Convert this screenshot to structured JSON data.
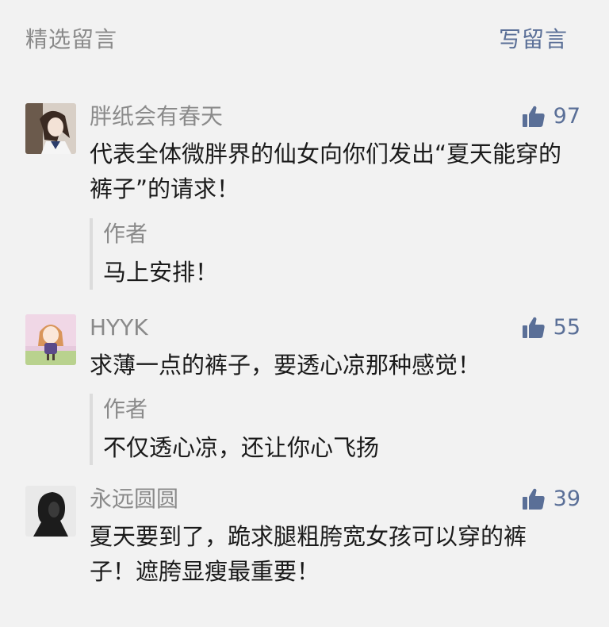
{
  "header": {
    "title": "精选留言",
    "write_label": "写留言"
  },
  "colors": {
    "background": "#f2f2f2",
    "link": "#5a6f97",
    "muted": "#8a8a8a",
    "text": "#1a1a1a"
  },
  "comments": [
    {
      "nickname": "胖纸会有春天",
      "likes": "97",
      "content": "代表全体微胖界的仙女向你们发出“夏天能穿的裤子”的请求！",
      "reply": {
        "author": "作者",
        "text": "马上安排！"
      }
    },
    {
      "nickname": "HYYK",
      "likes": "55",
      "content": "求薄一点的裤子，要透心凉那种感觉！",
      "reply": {
        "author": "作者",
        "text": "不仅透心凉，还让你心飞扬"
      }
    },
    {
      "nickname": "永远圆圆",
      "likes": "39",
      "content": "夏天要到了，跪求腿粗胯宽女孩可以穿的裤子！遮胯显瘦最重要！"
    }
  ]
}
